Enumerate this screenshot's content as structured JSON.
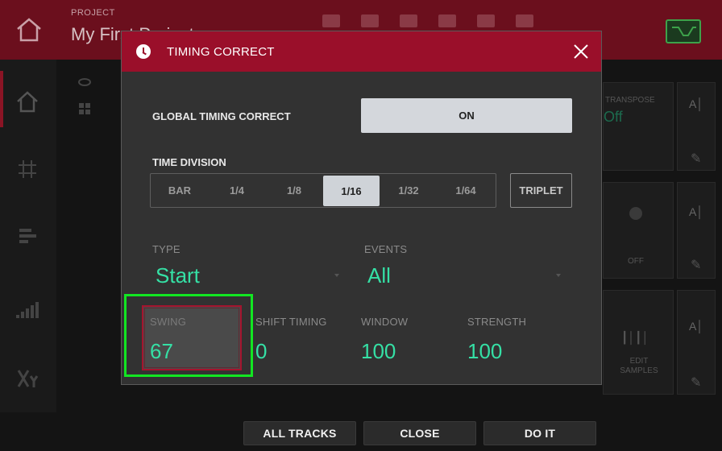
{
  "app": {
    "project_subtitle": "PROJECT",
    "project_name": "My First Project",
    "bg_transpose_label": "TRANSPOSE",
    "bg_transpose_value": "Off",
    "bg_off_label": "OFF",
    "bg_edit_samples": "EDIT SAMPLES"
  },
  "dialog": {
    "title": "TIMING CORRECT",
    "global_label": "GLOBAL TIMING CORRECT",
    "global_value": "ON",
    "time_division_label": "TIME DIVISION",
    "divisions": [
      "BAR",
      "1/4",
      "1/8",
      "1/16",
      "1/32",
      "1/64"
    ],
    "selected_division": "1/16",
    "triplet_label": "TRIPLET",
    "type_label": "TYPE",
    "type_value": "Start",
    "events_label": "EVENTS",
    "events_value": "All",
    "swing_label": "SWING",
    "swing_value": "67",
    "shift_label": "SHIFT TIMING",
    "shift_value": "0",
    "window_label": "WINDOW",
    "window_value": "100",
    "strength_label": "STRENGTH",
    "strength_value": "100"
  },
  "footer": {
    "all_tracks": "ALL TRACKS",
    "close": "CLOSE",
    "do_it": "DO IT"
  },
  "colors": {
    "accent_red": "#9a0f2a",
    "value_green": "#35e0a5",
    "highlight_green": "#12e622"
  }
}
